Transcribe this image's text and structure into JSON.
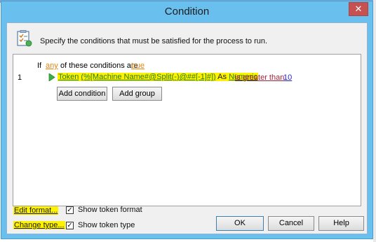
{
  "window": {
    "title": "Condition",
    "close_symbol": "✕"
  },
  "instruction": {
    "icon": "checklist-icon",
    "text": "Specify the conditions that must be satisfied for the process to run."
  },
  "condition_header": {
    "if_label": "If",
    "quantifier": "any",
    "middle_text": "of these conditions are",
    "truth_value": "true"
  },
  "conditions": [
    {
      "number": "1",
      "token_keyword": "Token",
      "token_expression": "(%[Machine Name#@Split(-)@##[-1]#])",
      "as_text": "As",
      "type": "Numeric",
      "operator": "is greater than",
      "value": "10"
    }
  ],
  "buttons": {
    "add_condition": "Add condition",
    "add_group": "Add group",
    "ok": "OK",
    "cancel": "Cancel",
    "help": "Help"
  },
  "links": {
    "edit_format": "Edit format...",
    "change_type": "Change type..."
  },
  "checkboxes": {
    "show_token_format": {
      "label": "Show token format",
      "checked": true
    },
    "show_token_type": {
      "label": "Show token type",
      "checked": true
    }
  },
  "colors": {
    "title_bar": "#69c0ee",
    "highlight": "#fff200",
    "quantifier": "#e8820c",
    "operator": "#a0253a",
    "value": "#2222cc",
    "token": "#1f7a1f"
  }
}
